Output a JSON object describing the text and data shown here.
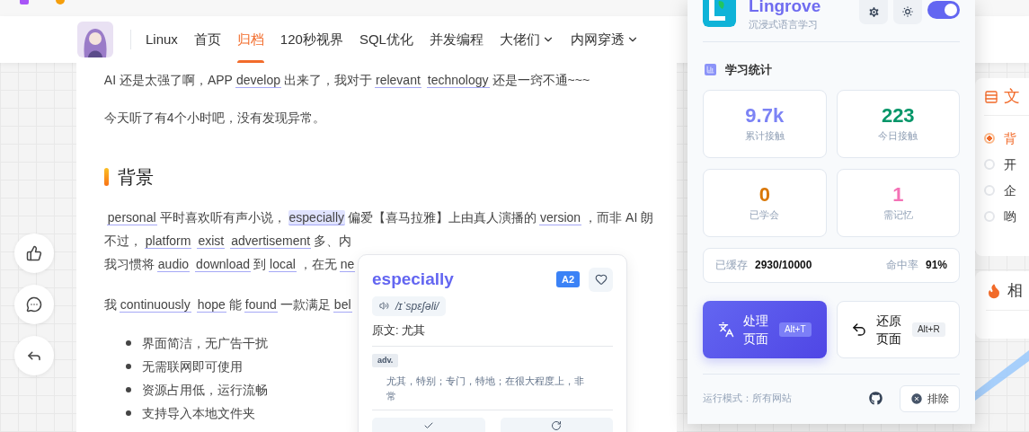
{
  "nav": {
    "items": [
      {
        "label": "Linux",
        "selected": false,
        "dropdown": false
      },
      {
        "label": "首页",
        "selected": false,
        "dropdown": false
      },
      {
        "label": "归档",
        "selected": true,
        "dropdown": false
      },
      {
        "label": "120秒视界",
        "selected": false,
        "dropdown": false
      },
      {
        "label": "SQL优化",
        "selected": false,
        "dropdown": false
      },
      {
        "label": "并发编程",
        "selected": false,
        "dropdown": false
      },
      {
        "label": "大佬们",
        "selected": false,
        "dropdown": true
      },
      {
        "label": "内网穿透",
        "selected": false,
        "dropdown": true
      }
    ]
  },
  "article": {
    "blocks": [
      {
        "kind": "para",
        "lines": [
          [
            {
              "kind": "plain",
              "text": "AI 还是太强了啊，APP"
            },
            {
              "kind": "word",
              "text": "develop",
              "selected": false
            },
            {
              "kind": "plain",
              "text": "出来了，我对于"
            },
            {
              "kind": "word",
              "text": "relevant",
              "selected": false
            },
            {
              "kind": "word",
              "text": "technology",
              "selected": false
            },
            {
              "kind": "plain",
              "text": "还是一窍不通~~~"
            }
          ]
        ]
      },
      {
        "kind": "para",
        "lines": [
          [
            {
              "kind": "plain",
              "text": "今天听了有4个小时吧，没有发现异常。"
            }
          ]
        ]
      },
      {
        "kind": "heading",
        "text": "背景"
      },
      {
        "kind": "para",
        "lines": [
          [
            {
              "kind": "word",
              "text": "personal",
              "selected": false
            },
            {
              "kind": "plain",
              "text": "平时喜欢听有声小说，"
            },
            {
              "kind": "word",
              "text": "especially",
              "selected": true
            },
            {
              "kind": "plain",
              "text": "偏爱【喜马拉雅】上由真人演播的"
            },
            {
              "kind": "word",
              "text": "version",
              "selected": false
            },
            {
              "kind": "plain",
              "text": "，而非 AI 朗"
            }
          ],
          [
            {
              "kind": "plain",
              "text": "不过，"
            },
            {
              "kind": "word",
              "text": "platform",
              "selected": false
            },
            {
              "kind": "word",
              "text": "exist",
              "selected": false
            },
            {
              "kind": "word",
              "text": "advertisement",
              "selected": false
            },
            {
              "kind": "plain",
              "text": "多、内"
            }
          ],
          [
            {
              "kind": "plain",
              "text": "我习惯将"
            },
            {
              "kind": "word",
              "text": "audio",
              "selected": false
            },
            {
              "kind": "word",
              "text": "download",
              "selected": false
            },
            {
              "kind": "plain",
              "text": "到"
            },
            {
              "kind": "word",
              "text": "local",
              "selected": false
            },
            {
              "kind": "plain",
              "text": "，在无"
            },
            {
              "kind": "word",
              "text": "ne",
              "selected": false
            }
          ]
        ]
      },
      {
        "kind": "para",
        "lines": [
          [
            {
              "kind": "plain",
              "text": "我"
            },
            {
              "kind": "word",
              "text": "continuously",
              "selected": false
            },
            {
              "kind": "word",
              "text": "hope",
              "selected": false
            },
            {
              "kind": "plain",
              "text": "能"
            },
            {
              "kind": "word",
              "text": "found",
              "selected": false
            },
            {
              "kind": "plain",
              "text": "一款满足"
            },
            {
              "kind": "word",
              "text": "bel",
              "selected": false
            }
          ]
        ]
      },
      {
        "kind": "list",
        "items": [
          "界面简洁，无广告干扰",
          "无需联网即可使用",
          "资源占用低，运行流畅",
          "支持导入本地文件夹"
        ]
      }
    ]
  },
  "toc": {
    "title": "文",
    "items": [
      {
        "label": "背",
        "selected": true
      },
      {
        "label": "开",
        "selected": false
      },
      {
        "label": "企",
        "selected": false
      },
      {
        "label": "哟",
        "selected": false
      }
    ]
  },
  "related": {
    "title": "相"
  },
  "word_popup": {
    "word": "especially",
    "cefr": "A2",
    "favorite": false,
    "phonetic": "/ɪˈspɛʃəli/",
    "original": "原文: 尤其",
    "pos": "adv.",
    "definition": "尤其，特别；专门，特地；在很大程度上，非常"
  },
  "lingrove": {
    "title": "Lingrove",
    "subtitle": "沉浸式语言学习",
    "enabled": true,
    "stats_title": "学习统计",
    "stats": [
      {
        "value": "9.7k",
        "label": "累计接触",
        "color": "#7c83f5"
      },
      {
        "value": "223",
        "label": "今日接触",
        "color": "#059669"
      },
      {
        "value": "0",
        "label": "已学会",
        "color": "#d97706"
      },
      {
        "value": "1",
        "label": "需记忆",
        "color": "#f472b6"
      }
    ],
    "cache": {
      "label": "已缓存",
      "value": "2930/10000",
      "hit_label": "命中率",
      "hit_value": "91%"
    },
    "actions": [
      {
        "kind": "primary",
        "label": "处理页面",
        "shortcut": "Alt+T"
      },
      {
        "kind": "secondary",
        "label": "还原页面",
        "shortcut": "Alt+R"
      }
    ],
    "mode": "运行模式：所有网站",
    "exclude": "排除"
  }
}
